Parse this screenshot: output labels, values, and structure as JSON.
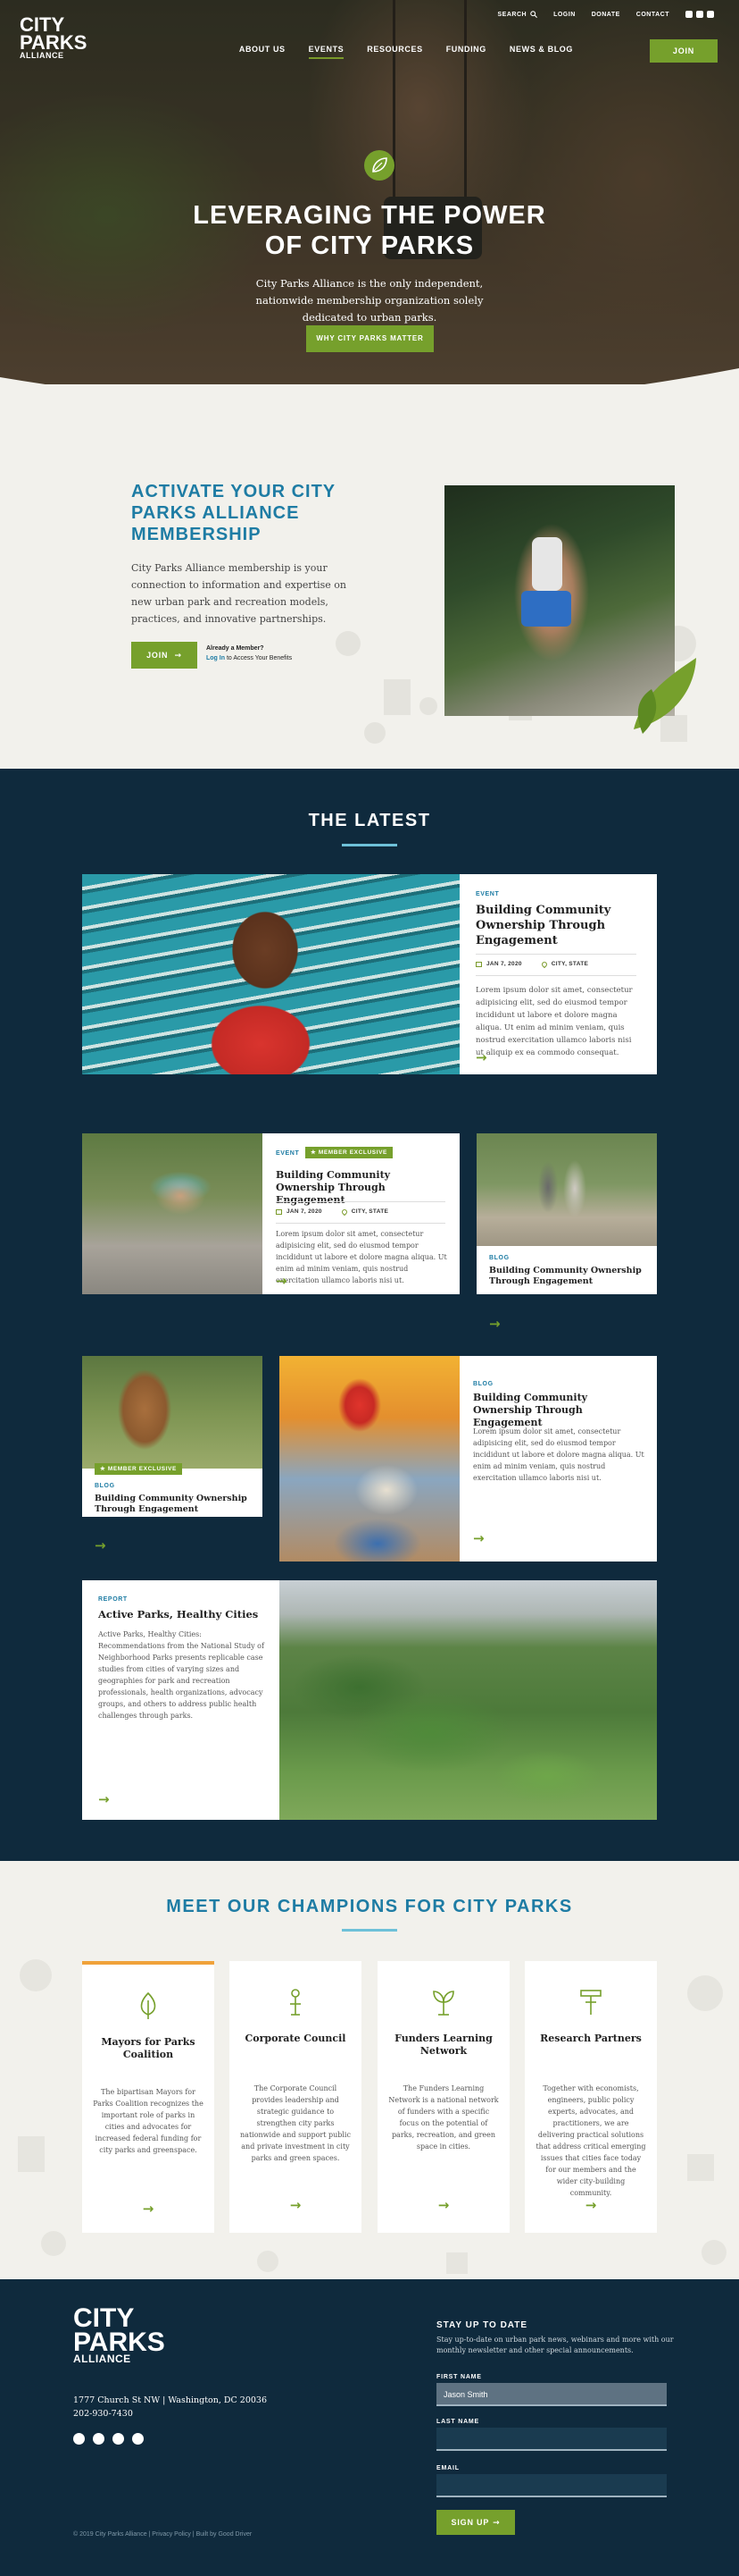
{
  "brand": {
    "line1": "CITY",
    "line2": "PARKS",
    "line3": "ALLIANCE"
  },
  "utility_nav": {
    "search": "SEARCH",
    "login": "LOGIN",
    "donate": "DONATE",
    "contact": "CONTACT"
  },
  "main_nav": {
    "items": [
      "ABOUT US",
      "EVENTS",
      "RESOURCES",
      "FUNDING",
      "NEWS & BLOG"
    ],
    "join": "JOIN"
  },
  "hero": {
    "title_line1": "LEVERAGING THE POWER",
    "title_line2": "OF CITY PARKS",
    "subtitle": "City Parks Alliance is the only independent, nationwide membership organization solely dedicated to urban parks.",
    "cta": "WHY CITY PARKS MATTER"
  },
  "activate": {
    "heading": "ACTIVATE YOUR CITY PARKS ALLIANCE MEMBERSHIP",
    "body": "City Parks Alliance membership is your connection to information and expertise on new urban park and recreation models, practices, and innovative partnerships.",
    "join": "JOIN",
    "already": "Already a Member?",
    "login_link": "Log In",
    "login_rest": " to Access Your Benefits"
  },
  "latest": {
    "title": "THE LATEST",
    "featured": {
      "tag": "EVENT",
      "title": "Building Community Ownership Through Engagement",
      "date": "JAN 7, 2020",
      "location": "CITY, STATE",
      "text": "Lorem ipsum dolor sit amet, consectetur adipisicing elit, sed do eiusmod tempor incididunt ut labore et dolore magna aliqua. Ut enim ad minim veniam, quis nostrud exercitation ullamco laboris nisi ut aliquip ex ea commodo consequat."
    },
    "card2": {
      "tag": "EVENT",
      "exclusive": "MEMBER EXCLUSIVE",
      "title": "Building Community Ownership Through Engagement",
      "date": "JAN 7, 2020",
      "location": "CITY, STATE",
      "text": "Lorem ipsum dolor sit amet, consectetur adipisicing elit, sed do eiusmod tempor incididunt ut labore et dolore magna aliqua. Ut enim ad minim veniam, quis nostrud exercitation ullamco laboris nisi ut."
    },
    "card3": {
      "tag": "BLOG",
      "title": "Building Community Ownership Through Engagement"
    },
    "card4": {
      "exclusive": "MEMBER EXCLUSIVE",
      "tag": "BLOG",
      "title": "Building Community Ownership Through Engagement"
    },
    "card5": {
      "tag": "BLOG",
      "title": "Building Community Ownership Through Engagement",
      "text": "Lorem ipsum dolor sit amet, consectetur adipisicing elit, sed do eiusmod tempor incididunt ut labore et dolore magna aliqua. Ut enim ad minim veniam, quis nostrud exercitation ullamco laboris nisi ut."
    },
    "card6": {
      "tag": "REPORT",
      "title": "Active Parks, Healthy Cities",
      "text": "Active Parks, Healthy Cities: Recommendations from the National Study of Neighborhood Parks presents replicable case studies from cities of varying sizes and geographies for park and recreation professionals, health organizations, advocacy groups, and others to address public health challenges through parks."
    }
  },
  "champions": {
    "title": "MEET OUR CHAMPIONS FOR CITY PARKS",
    "cards": [
      {
        "icon": "leaf-icon",
        "title": "Mayors for Parks Coalition",
        "text": "The bipartisan Mayors for Parks Coalition recognizes the important role of parks in cities and advocates for increased federal funding for city parks and greenspace."
      },
      {
        "icon": "lamp-icon",
        "title": "Corporate Council",
        "text": "The Corporate Council provides leadership and strategic guidance to strengthen city parks nationwide and support public and private investment in city parks and green spaces."
      },
      {
        "icon": "sprout-icon",
        "title": "Funders Learning Network",
        "text": "The Funders Learning Network is a national network of funders with a specific focus on the potential of parks, recreation, and green space in cities."
      },
      {
        "icon": "sign-icon",
        "title": "Research Partners",
        "text": "Together with economists, engineers, public policy experts, advocates, and practitioners, we are delivering practical solutions that address critical emerging issues that cities face today for our members and the wider city-building community."
      }
    ]
  },
  "footer": {
    "address": "1777 Church St NW  |  Washington, DC 20036",
    "phone": "202-930-7430",
    "copyright": "© 2019 City Parks Alliance  |  Privacy Policy  |  Built by Good Driver",
    "newsletter_title": "STAY UP TO DATE",
    "newsletter_text": "Stay up-to-date on urban park news, webinars and more with our monthly newsletter and other special announcements.",
    "first_name_label": "FIRST NAME",
    "first_name_value": "Jason Smith",
    "last_name_label": "LAST NAME",
    "email_label": "EMAIL",
    "signup": "SIGN UP"
  },
  "colors": {
    "accent_green": "#76a02c",
    "accent_blue": "#1e7ca4",
    "navy": "#0f2a3d"
  }
}
